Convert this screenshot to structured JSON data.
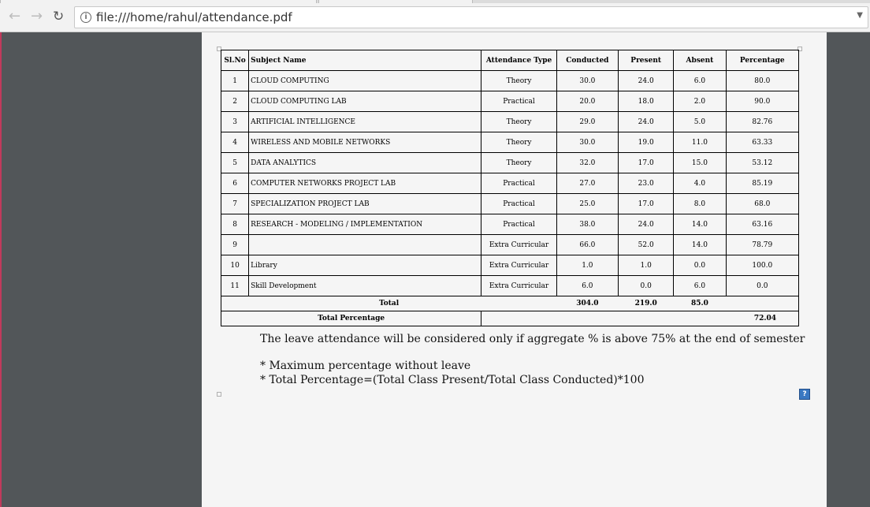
{
  "browser": {
    "url": "file:///home/rahul/attendance.pdf"
  },
  "table": {
    "headers": [
      "Sl.No",
      "Subject Name",
      "Attendance Type",
      "Conducted",
      "Present",
      "Absent",
      "Percentage"
    ],
    "rows": [
      {
        "no": "1",
        "subject": "CLOUD COMPUTING",
        "type": "Theory",
        "conducted": "30.0",
        "present": "24.0",
        "absent": "6.0",
        "percentage": "80.0"
      },
      {
        "no": "2",
        "subject": "CLOUD COMPUTING LAB",
        "type": "Practical",
        "conducted": "20.0",
        "present": "18.0",
        "absent": "2.0",
        "percentage": "90.0"
      },
      {
        "no": "3",
        "subject": "ARTIFICIAL INTELLIGENCE",
        "type": "Theory",
        "conducted": "29.0",
        "present": "24.0",
        "absent": "5.0",
        "percentage": "82.76"
      },
      {
        "no": "4",
        "subject": "WIRELESS AND MOBILE NETWORKS",
        "type": "Theory",
        "conducted": "30.0",
        "present": "19.0",
        "absent": "11.0",
        "percentage": "63.33"
      },
      {
        "no": "5",
        "subject": "DATA ANALYTICS",
        "type": "Theory",
        "conducted": "32.0",
        "present": "17.0",
        "absent": "15.0",
        "percentage": "53.12"
      },
      {
        "no": "6",
        "subject": "COMPUTER NETWORKS PROJECT LAB",
        "type": "Practical",
        "conducted": "27.0",
        "present": "23.0",
        "absent": "4.0",
        "percentage": "85.19"
      },
      {
        "no": "7",
        "subject": "SPECIALIZATION PROJECT LAB",
        "type": "Practical",
        "conducted": "25.0",
        "present": "17.0",
        "absent": "8.0",
        "percentage": "68.0"
      },
      {
        "no": "8",
        "subject": "RESEARCH - MODELING / IMPLEMENTATION",
        "type": "Practical",
        "conducted": "38.0",
        "present": "24.0",
        "absent": "14.0",
        "percentage": "63.16"
      },
      {
        "no": "9",
        "subject": "",
        "type": "Extra Curricular",
        "conducted": "66.0",
        "present": "52.0",
        "absent": "14.0",
        "percentage": "78.79"
      },
      {
        "no": "10",
        "subject": "Library",
        "type": "Extra Curricular",
        "conducted": "1.0",
        "present": "1.0",
        "absent": "0.0",
        "percentage": "100.0"
      },
      {
        "no": "11",
        "subject": "Skill Development",
        "type": "Extra Curricular",
        "conducted": "6.0",
        "present": "0.0",
        "absent": "6.0",
        "percentage": "0.0"
      }
    ],
    "total": {
      "label": "Total",
      "conducted": "304.0",
      "present": "219.0",
      "absent": "85.0"
    },
    "total_percentage": {
      "label": "Total Percentage",
      "value": "72.04"
    }
  },
  "notes": {
    "leave": "The leave attendance will be considered only if aggregate % is above 75% at the end of semester",
    "line1": "* Maximum percentage without leave",
    "line2": "* Total Percentage=(Total Class Present/Total Class Conducted)*100"
  },
  "icons": {
    "back": "back-arrow-icon",
    "forward": "forward-arrow-icon",
    "reload": "reload-icon",
    "info": "info-icon",
    "help": "help-icon"
  }
}
